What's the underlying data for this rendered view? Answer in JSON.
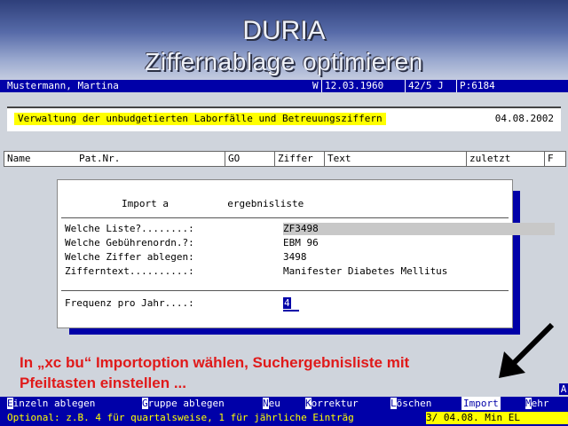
{
  "banner": {
    "title": "DURIA",
    "subtitle": "Ziffernablage optimieren"
  },
  "patient": {
    "name": "Mustermann, Martina",
    "sex": "W",
    "birthdate": "12.03.1960",
    "age": "42/5 J",
    "pid": "P:6184"
  },
  "info": {
    "text": "Verwaltung der unbudgetierten Laborfälle und Betreuungsziffern",
    "date": "04.08.2002"
  },
  "columns": [
    "Name",
    "Pat.Nr.",
    "GO",
    "Ziffer",
    "Text",
    "zuletzt",
    "F"
  ],
  "dialog": {
    "title": "Import a          ergebnisliste",
    "fields": [
      {
        "label": "Welche Liste?........:",
        "value": "ZF3498"
      },
      {
        "label": "Welche Gebührenordn.?:",
        "value": "EBM 96"
      },
      {
        "label": "Welche Ziffer ablegen:",
        "value": "3498"
      },
      {
        "label": "Zifferntext..........:",
        "value": "Manifester Diabetes Mellitus"
      }
    ],
    "freq_label": "Frequenz pro Jahr....:",
    "freq_value": "4"
  },
  "hint": {
    "line1": "In „xc bu“ Importoption wählen, Suchergebnisliste mit",
    "line2": "Pfeiltasten einstellen ..."
  },
  "menu": {
    "scroll_indicator": "A",
    "items": [
      {
        "hotkey": "E",
        "rest": "inzeln ablegen"
      },
      {
        "hotkey": "G",
        "rest": "ruppe ablegen"
      },
      {
        "hotkey": "N",
        "rest": "eu"
      },
      {
        "hotkey": "K",
        "rest": "orrektur"
      },
      {
        "hotkey": "L",
        "rest": "öschen"
      },
      {
        "hotkey": "I",
        "rest": "mport"
      },
      {
        "hotkey": "M",
        "rest": "ehr"
      }
    ]
  },
  "status": {
    "text": "Optional: z.B. 4 für quartalsweise, 1 für jährliche Einträg",
    "right": "3/ 04.08. Min EL"
  },
  "colors": {
    "dos_blue": "#0000a8",
    "highlight_yellow": "#ffff00",
    "annotation_red": "#e01a1a"
  }
}
